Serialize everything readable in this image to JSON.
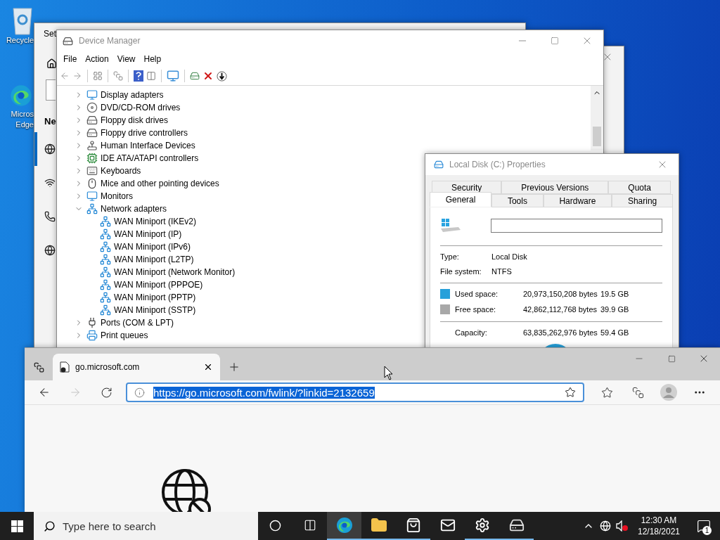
{
  "desktop_icons": [
    {
      "kind": "recycle",
      "lines": [
        "Recycle"
      ]
    },
    {
      "kind": "edge",
      "lines": [
        "Micros",
        "Edge"
      ]
    }
  ],
  "settings_window": {
    "title": "Set",
    "heading": "Ne",
    "nav": [
      {
        "kind": "globe",
        "selected": true
      },
      {
        "kind": "wifi",
        "selected": false
      },
      {
        "kind": "dialup",
        "selected": false
      },
      {
        "kind": "globe",
        "selected": false
      }
    ]
  },
  "device_manager": {
    "title": "Device Manager",
    "menu": [
      "File",
      "Action",
      "View",
      "Help"
    ],
    "tree": [
      {
        "label": "Display adapters",
        "kind": "display",
        "expanded": false
      },
      {
        "label": "DVD/CD-ROM drives",
        "kind": "dvd",
        "expanded": false
      },
      {
        "label": "Floppy disk drives",
        "kind": "floppy",
        "expanded": false
      },
      {
        "label": "Floppy drive controllers",
        "kind": "floppy",
        "expanded": false
      },
      {
        "label": "Human Interface Devices",
        "kind": "hid",
        "expanded": false
      },
      {
        "label": "IDE ATA/ATAPI controllers",
        "kind": "chip",
        "expanded": false
      },
      {
        "label": "Keyboards",
        "kind": "keyboard",
        "expanded": false
      },
      {
        "label": "Mice and other pointing devices",
        "kind": "mouse",
        "expanded": false
      },
      {
        "label": "Monitors",
        "kind": "monitor",
        "expanded": false
      },
      {
        "label": "Network adapters",
        "kind": "network",
        "expanded": true,
        "children": [
          {
            "label": "WAN Miniport (IKEv2)",
            "kind": "network"
          },
          {
            "label": "WAN Miniport (IP)",
            "kind": "network"
          },
          {
            "label": "WAN Miniport (IPv6)",
            "kind": "network"
          },
          {
            "label": "WAN Miniport (L2TP)",
            "kind": "network"
          },
          {
            "label": "WAN Miniport (Network Monitor)",
            "kind": "network"
          },
          {
            "label": "WAN Miniport (PPPOE)",
            "kind": "network"
          },
          {
            "label": "WAN Miniport (PPTP)",
            "kind": "network"
          },
          {
            "label": "WAN Miniport (SSTP)",
            "kind": "network"
          }
        ]
      },
      {
        "label": "Ports (COM & LPT)",
        "kind": "port",
        "expanded": false
      },
      {
        "label": "Print queues",
        "kind": "printer",
        "expanded": false
      }
    ]
  },
  "properties": {
    "title": "Local Disk (C:) Properties",
    "tabs": [
      [
        {
          "label": "Security",
          "selected": false
        },
        {
          "label": "Previous Versions",
          "selected": false
        },
        {
          "label": "Quota",
          "selected": false
        }
      ],
      [
        {
          "label": "General",
          "selected": true
        },
        {
          "label": "Tools",
          "selected": false
        },
        {
          "label": "Hardware",
          "selected": false
        },
        {
          "label": "Sharing",
          "selected": false
        }
      ]
    ],
    "info": [
      {
        "label": "Type:",
        "value": "Local Disk"
      },
      {
        "label": "File system:",
        "value": "NTFS"
      }
    ],
    "space": [
      {
        "label": "Used space:",
        "bytes": "20,973,150,208 bytes",
        "size": "19.5 GB",
        "color": "#26a0da"
      },
      {
        "label": "Free space:",
        "bytes": "42,862,112,768 bytes",
        "size": "39.9 GB",
        "color": "#a8a8a8"
      }
    ],
    "capacity": {
      "label": "Capacity:",
      "bytes": "63,835,262,976 bytes",
      "size": "59.4 GB"
    }
  },
  "browser": {
    "tab_title": "go.microsoft.com",
    "url": "https://go.microsoft.com/fwlink/?linkid=2132659",
    "url_selected": true,
    "forward_disabled": true
  },
  "taskbar": {
    "search_placeholder": "Type here to search",
    "apps": [
      {
        "kind": "edge",
        "running": true,
        "selected": true
      },
      {
        "kind": "explorer",
        "running": true,
        "selected": false
      },
      {
        "kind": "store",
        "running": true,
        "selected": false
      },
      {
        "kind": "mail",
        "running": false,
        "selected": false
      },
      {
        "kind": "settings",
        "running": true,
        "selected": false
      },
      {
        "kind": "devices",
        "running": true,
        "selected": false
      }
    ],
    "volume_muted": true,
    "time": "12:30 AM",
    "date": "12/18/2021",
    "notifications": "1"
  }
}
